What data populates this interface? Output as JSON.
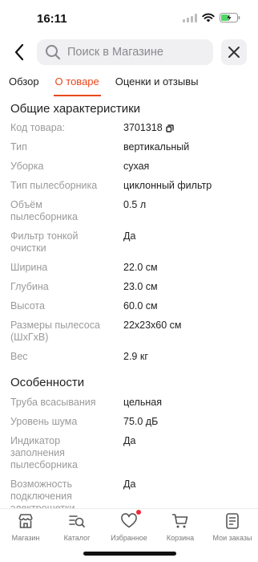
{
  "status_bar": {
    "time": "16:11"
  },
  "search": {
    "placeholder": "Поиск в Магазине"
  },
  "tabs": [
    {
      "label": "Обзор",
      "active": false
    },
    {
      "label": "О товаре",
      "active": true
    },
    {
      "label": "Оценки и отзывы",
      "active": false
    }
  ],
  "sections": [
    {
      "title": "Общие характеристики",
      "rows": [
        {
          "label": "Код товара:",
          "value": "3701318"
        },
        {
          "label": "Тип",
          "value": "вертикальный"
        },
        {
          "label": "Уборка",
          "value": "сухая"
        },
        {
          "label": "Тип пылесборника",
          "value": "циклонный фильтр"
        },
        {
          "label": "Объём пылесборника",
          "value": "0.5 л"
        },
        {
          "label": "Фильтр тонкой очистки",
          "value": "Да"
        },
        {
          "label": "Ширина",
          "value": "22.0 см"
        },
        {
          "label": "Глубина",
          "value": "23.0 см"
        },
        {
          "label": "Высота",
          "value": "60.0 см"
        },
        {
          "label": "Размеры пылесоса (ШхГхВ)",
          "value": "22x23x60 см"
        },
        {
          "label": "Вес",
          "value": "2.9 кг"
        }
      ]
    },
    {
      "title": "Особенности",
      "rows": [
        {
          "label": "Труба всасывания",
          "value": "цельная"
        },
        {
          "label": "Уровень шума",
          "value": "75.0 дБ"
        },
        {
          "label": "Индикатор заполнения пылесборника",
          "value": "Да"
        },
        {
          "label": "Возможность подключения электрощетки",
          "value": "Да"
        }
      ]
    }
  ],
  "bottom_nav": [
    {
      "label": "Магазин",
      "icon": "shop-icon"
    },
    {
      "label": "Каталог",
      "icon": "catalog-search-icon"
    },
    {
      "label": "Избранное",
      "icon": "heart-icon",
      "badge": true
    },
    {
      "label": "Корзина",
      "icon": "cart-icon"
    },
    {
      "label": "Мои заказы",
      "icon": "orders-icon"
    }
  ],
  "colors": {
    "accent": "#e8491d",
    "badge": "#f1263b",
    "label": "#9a9a9a"
  }
}
